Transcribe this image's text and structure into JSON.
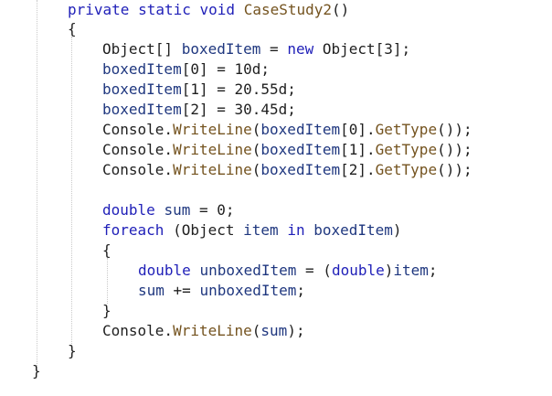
{
  "editor": {
    "colors": {
      "keyword": "#1f1fb8",
      "method": "#74531f",
      "variable": "#1f377f",
      "plain": "#1f1f1f",
      "background": "#ffffff"
    },
    "lines": [
      {
        "tokens": [
          {
            "t": "kw",
            "v": "private"
          },
          {
            "t": "plain",
            "v": " "
          },
          {
            "t": "kw",
            "v": "static"
          },
          {
            "t": "plain",
            "v": " "
          },
          {
            "t": "kw",
            "v": "void"
          },
          {
            "t": "plain",
            "v": " "
          },
          {
            "t": "meth",
            "v": "CaseStudy2"
          },
          {
            "t": "plain",
            "v": "()"
          }
        ]
      },
      {
        "tokens": [
          {
            "t": "plain",
            "v": "{"
          }
        ]
      },
      {
        "tokens": [
          {
            "t": "plain",
            "v": "Object[] "
          },
          {
            "t": "var",
            "v": "boxedItem"
          },
          {
            "t": "plain",
            "v": " = "
          },
          {
            "t": "kw",
            "v": "new"
          },
          {
            "t": "plain",
            "v": " Object[3];"
          }
        ]
      },
      {
        "tokens": [
          {
            "t": "var",
            "v": "boxedItem"
          },
          {
            "t": "plain",
            "v": "[0] = 10d;"
          }
        ]
      },
      {
        "tokens": [
          {
            "t": "var",
            "v": "boxedItem"
          },
          {
            "t": "plain",
            "v": "[1] = 20.55d;"
          }
        ]
      },
      {
        "tokens": [
          {
            "t": "var",
            "v": "boxedItem"
          },
          {
            "t": "plain",
            "v": "[2] = 30.45d;"
          }
        ]
      },
      {
        "tokens": [
          {
            "t": "plain",
            "v": "Console."
          },
          {
            "t": "meth",
            "v": "WriteLine"
          },
          {
            "t": "plain",
            "v": "("
          },
          {
            "t": "var",
            "v": "boxedItem"
          },
          {
            "t": "plain",
            "v": "[0]."
          },
          {
            "t": "meth",
            "v": "GetType"
          },
          {
            "t": "plain",
            "v": "());"
          }
        ]
      },
      {
        "tokens": [
          {
            "t": "plain",
            "v": "Console."
          },
          {
            "t": "meth",
            "v": "WriteLine"
          },
          {
            "t": "plain",
            "v": "("
          },
          {
            "t": "var",
            "v": "boxedItem"
          },
          {
            "t": "plain",
            "v": "[1]."
          },
          {
            "t": "meth",
            "v": "GetType"
          },
          {
            "t": "plain",
            "v": "());"
          }
        ]
      },
      {
        "tokens": [
          {
            "t": "plain",
            "v": "Console."
          },
          {
            "t": "meth",
            "v": "WriteLine"
          },
          {
            "t": "plain",
            "v": "("
          },
          {
            "t": "var",
            "v": "boxedItem"
          },
          {
            "t": "plain",
            "v": "[2]."
          },
          {
            "t": "meth",
            "v": "GetType"
          },
          {
            "t": "plain",
            "v": "());"
          }
        ]
      },
      {
        "tokens": []
      },
      {
        "tokens": [
          {
            "t": "kw",
            "v": "double"
          },
          {
            "t": "plain",
            "v": " "
          },
          {
            "t": "var",
            "v": "sum"
          },
          {
            "t": "plain",
            "v": " = 0;"
          }
        ]
      },
      {
        "tokens": [
          {
            "t": "kw",
            "v": "foreach"
          },
          {
            "t": "plain",
            "v": " (Object "
          },
          {
            "t": "var",
            "v": "item"
          },
          {
            "t": "plain",
            "v": " "
          },
          {
            "t": "kw",
            "v": "in"
          },
          {
            "t": "plain",
            "v": " "
          },
          {
            "t": "var",
            "v": "boxedItem"
          },
          {
            "t": "plain",
            "v": ")"
          }
        ]
      },
      {
        "tokens": [
          {
            "t": "plain",
            "v": "{"
          }
        ]
      },
      {
        "tokens": [
          {
            "t": "kw",
            "v": "double"
          },
          {
            "t": "plain",
            "v": " "
          },
          {
            "t": "var",
            "v": "unboxedItem"
          },
          {
            "t": "plain",
            "v": " = ("
          },
          {
            "t": "kw",
            "v": "double"
          },
          {
            "t": "plain",
            "v": ")"
          },
          {
            "t": "var",
            "v": "item"
          },
          {
            "t": "plain",
            "v": ";"
          }
        ]
      },
      {
        "tokens": [
          {
            "t": "var",
            "v": "sum"
          },
          {
            "t": "plain",
            "v": " += "
          },
          {
            "t": "var",
            "v": "unboxedItem"
          },
          {
            "t": "plain",
            "v": ";"
          }
        ]
      },
      {
        "tokens": [
          {
            "t": "plain",
            "v": "}"
          }
        ]
      },
      {
        "tokens": [
          {
            "t": "plain",
            "v": "Console."
          },
          {
            "t": "meth",
            "v": "WriteLine"
          },
          {
            "t": "plain",
            "v": "("
          },
          {
            "t": "var",
            "v": "sum"
          },
          {
            "t": "plain",
            "v": ");"
          }
        ]
      },
      {
        "tokens": [
          {
            "t": "plain",
            "v": "}"
          }
        ]
      },
      {
        "tokens": [
          {
            "t": "plain",
            "v": "}"
          }
        ]
      }
    ]
  }
}
